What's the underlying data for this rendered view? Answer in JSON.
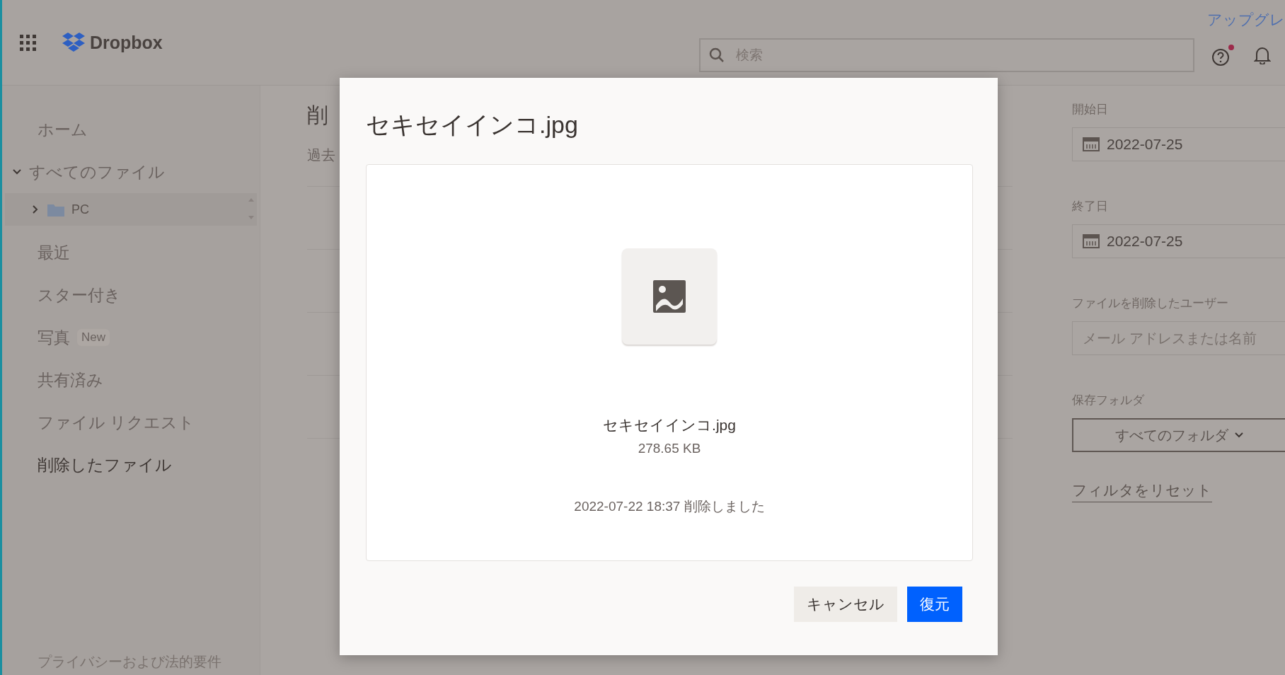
{
  "header": {
    "logo": "Dropbox",
    "search": {
      "placeholder": "検索"
    },
    "help_notification": true,
    "upgrade_link": "アップグレ"
  },
  "sidebar": {
    "items": [
      {
        "label": "ホーム",
        "selected": false
      },
      {
        "label": "すべてのファイル",
        "selected": false,
        "expanded": true,
        "children": [
          {
            "label": "PC",
            "expanded": false
          }
        ]
      },
      {
        "label": "最近",
        "selected": false
      },
      {
        "label": "スター付き",
        "selected": false
      },
      {
        "label": "写真",
        "selected": false,
        "badge": "New"
      },
      {
        "label": "共有済み",
        "selected": false
      },
      {
        "label": "ファイル リクエスト",
        "selected": false
      },
      {
        "label": "削除したファイル",
        "selected": true
      }
    ],
    "footer": "プライバシーおよび法的要件"
  },
  "main": {
    "title": "削",
    "subtitle": "過去"
  },
  "filters": {
    "start_date": {
      "label": "開始日",
      "value": "2022-07-25"
    },
    "end_date": {
      "label": "終了日",
      "value": "2022-07-25"
    },
    "deleted_by": {
      "label": "ファイルを削除したユーザー",
      "placeholder": "メール アドレスまたは名前"
    },
    "folder": {
      "label": "保存フォルダ",
      "value": "すべてのフォルダ"
    },
    "reset_link": "フィルタをリセット"
  },
  "dialog": {
    "title": "セキセイインコ.jpg",
    "file_name": "セキセイインコ.jpg",
    "file_size": "278.65 KB",
    "deleted_at": "2022-07-22 18:37 削除しました",
    "buttons": [
      {
        "label": "キャンセル",
        "kind": "secondary"
      },
      {
        "label": "復元",
        "kind": "primary"
      }
    ]
  }
}
